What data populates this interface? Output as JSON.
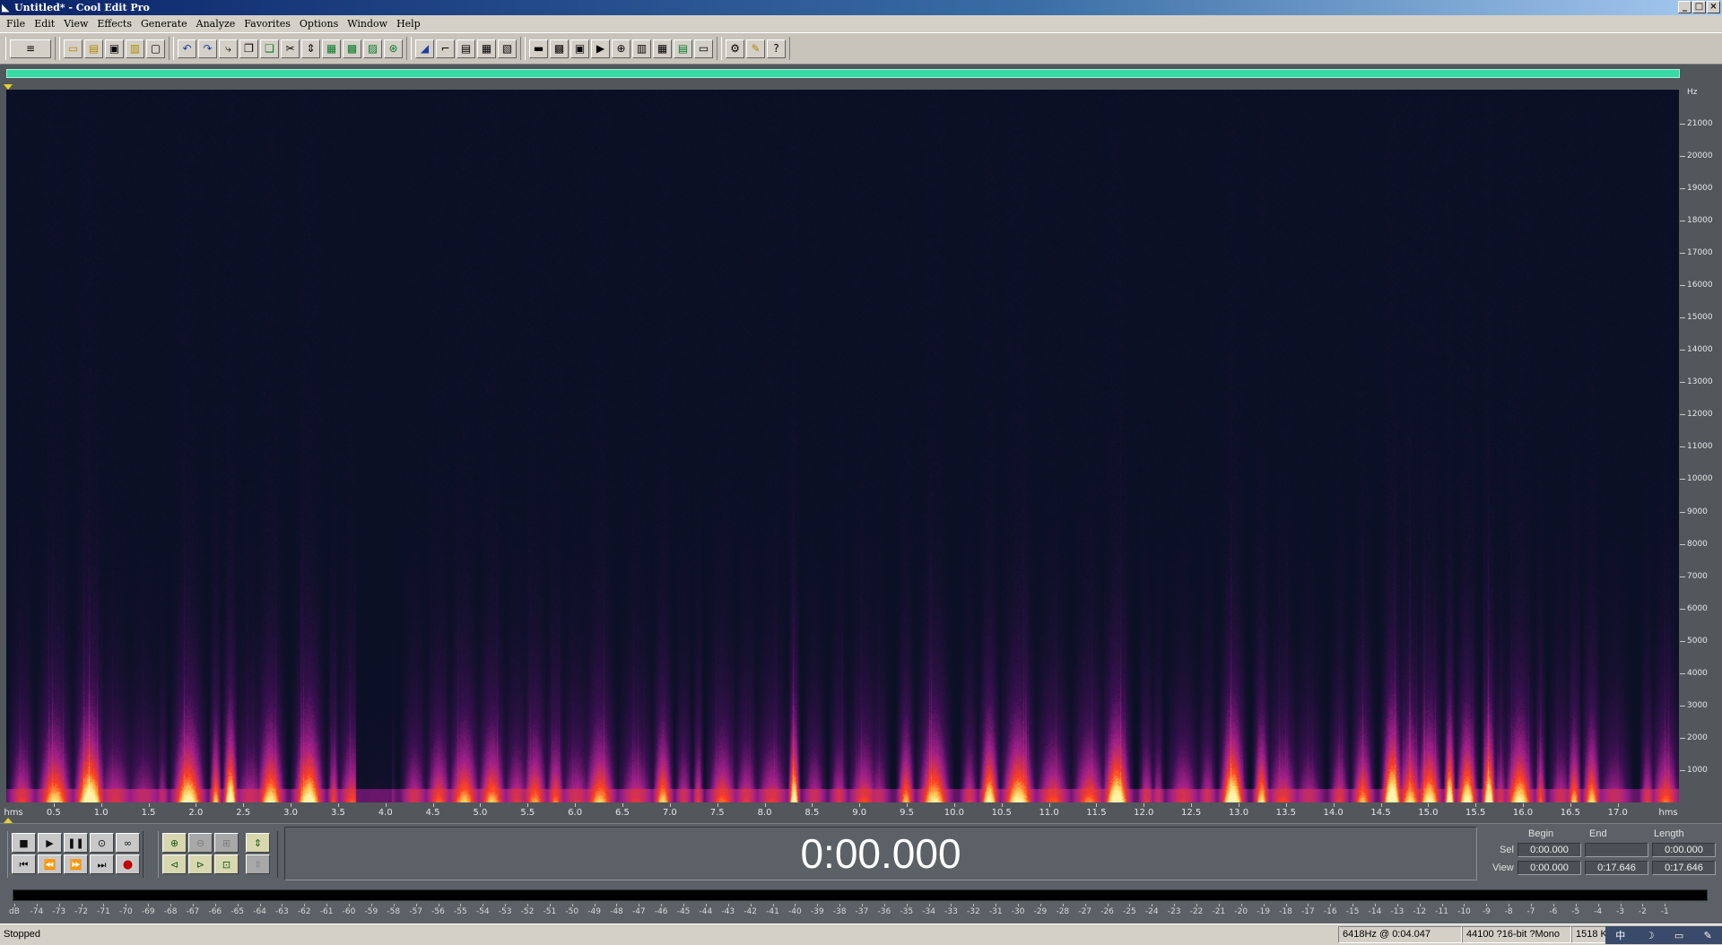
{
  "window": {
    "title": "Untitled* - Cool Edit Pro",
    "controls": [
      "_",
      "□",
      "×"
    ]
  },
  "menu": [
    "File",
    "Edit",
    "View",
    "Effects",
    "Generate",
    "Analyze",
    "Favorites",
    "Options",
    "Window",
    "Help"
  ],
  "toolbar": {
    "groups": [
      [
        {
          "icon": "waveform-toggle-icon",
          "glyph": "≡",
          "wide": true
        }
      ],
      [
        {
          "icon": "new-file-icon",
          "glyph": "▭",
          "c": "y"
        },
        {
          "icon": "open-file-icon",
          "glyph": "▤",
          "c": "y"
        },
        {
          "icon": "save-icon",
          "glyph": "▣"
        },
        {
          "icon": "save-as-icon",
          "glyph": "▥",
          "c": "y"
        },
        {
          "icon": "close-file-icon",
          "glyph": "▢"
        }
      ],
      [
        {
          "icon": "undo-icon",
          "glyph": "↶",
          "c": "b"
        },
        {
          "icon": "redo-icon",
          "glyph": "↷",
          "c": "b"
        },
        {
          "icon": "repeat-icon",
          "glyph": "⤷"
        },
        {
          "icon": "copy-icon",
          "glyph": "❐"
        },
        {
          "icon": "copy-new-icon",
          "glyph": "❏",
          "c": "g"
        },
        {
          "icon": "cut-icon",
          "glyph": "✂"
        },
        {
          "icon": "trim-icon",
          "glyph": "⇕"
        },
        {
          "icon": "paste-icon",
          "glyph": "▦",
          "c": "g"
        },
        {
          "icon": "paste-new-icon",
          "glyph": "▩",
          "c": "g"
        },
        {
          "icon": "mix-paste-icon",
          "glyph": "▨",
          "c": "g"
        },
        {
          "icon": "mix-icon",
          "glyph": "⊛",
          "c": "g"
        }
      ],
      [
        {
          "icon": "amplify-icon",
          "glyph": "◢",
          "c": "b"
        },
        {
          "icon": "envelope-icon",
          "glyph": "⌐"
        },
        {
          "icon": "noise-reduction-icon",
          "glyph": "▤"
        },
        {
          "icon": "filter-icon",
          "glyph": "▦"
        },
        {
          "icon": "eq-icon",
          "glyph": "▧"
        }
      ],
      [
        {
          "icon": "waveform-view-icon",
          "glyph": "▬"
        },
        {
          "icon": "spectral-view-icon",
          "glyph": "▩"
        },
        {
          "icon": "snap-icon",
          "glyph": "▣"
        },
        {
          "icon": "play-preview-icon",
          "glyph": "▶"
        },
        {
          "icon": "zoom-view-icon",
          "glyph": "⊕"
        },
        {
          "icon": "analyze-icon",
          "glyph": "▥"
        },
        {
          "icon": "cue-list-icon",
          "glyph": "▦"
        },
        {
          "icon": "info-icon",
          "glyph": "▤",
          "c": "g"
        },
        {
          "icon": "mono-icon",
          "glyph": "▭"
        }
      ],
      [
        {
          "icon": "settings-icon",
          "glyph": "⚙"
        },
        {
          "icon": "script-icon",
          "glyph": "✎",
          "c": "y"
        },
        {
          "icon": "help-icon",
          "glyph": "?"
        }
      ]
    ]
  },
  "spectral": {
    "y_unit": "Hz",
    "y_labels": [
      "21000",
      "20000",
      "19000",
      "18000",
      "17000",
      "16000",
      "15000",
      "14000",
      "13000",
      "12000",
      "11000",
      "10000",
      "9000",
      "8000",
      "7000",
      "6000",
      "5000",
      "4000",
      "3000",
      "2000",
      "1000"
    ],
    "x_unit": "hms",
    "x_labels": [
      "0.5",
      "1.0",
      "1.5",
      "2.0",
      "2.5",
      "3.0",
      "3.5",
      "4.0",
      "4.5",
      "5.0",
      "5.5",
      "6.0",
      "6.5",
      "7.0",
      "7.5",
      "8.0",
      "8.5",
      "9.0",
      "9.5",
      "10.0",
      "10.5",
      "11.0",
      "11.5",
      "12.0",
      "12.5",
      "13.0",
      "13.5",
      "14.0",
      "14.5",
      "15.0",
      "15.5",
      "16.0",
      "16.5",
      "17.0"
    ],
    "duration_s": 17.646,
    "max_hz": 22050,
    "colors": {
      "background": "#0a1024",
      "low": "#3a1050",
      "mid": "#a0208a",
      "high": "#ff4020",
      "peak": "#fff0a0"
    }
  },
  "transport": {
    "row1": [
      {
        "icon": "stop-icon",
        "glyph": "■"
      },
      {
        "icon": "play-icon",
        "glyph": "▶"
      },
      {
        "icon": "pause-icon",
        "glyph": "❚❚"
      },
      {
        "icon": "play-to-end-icon",
        "glyph": "⊙"
      },
      {
        "icon": "loop-icon",
        "glyph": "∞"
      }
    ],
    "row2": [
      {
        "icon": "go-to-start-icon",
        "glyph": "⏮"
      },
      {
        "icon": "rewind-icon",
        "glyph": "⏪"
      },
      {
        "icon": "fast-forward-icon",
        "glyph": "⏩"
      },
      {
        "icon": "go-to-end-icon",
        "glyph": "⏭"
      },
      {
        "icon": "record-icon",
        "glyph": "●",
        "rec": true
      }
    ],
    "zoom_row1": [
      {
        "icon": "zoom-in-icon",
        "glyph": "⊕",
        "on": true
      },
      {
        "icon": "zoom-out-icon",
        "glyph": "⊖",
        "on": false
      },
      {
        "icon": "zoom-full-icon",
        "glyph": "⊞",
        "on": false
      },
      {
        "icon": "zoom-vertical-in-icon",
        "glyph": "⇕",
        "on": true
      }
    ],
    "zoom_row2": [
      {
        "icon": "zoom-left-icon",
        "glyph": "⊲",
        "on": true
      },
      {
        "icon": "zoom-right-icon",
        "glyph": "⊳",
        "on": true
      },
      {
        "icon": "zoom-selection-icon",
        "glyph": "⊡",
        "on": true
      },
      {
        "icon": "zoom-vertical-out-icon",
        "glyph": "⇳",
        "on": false
      }
    ],
    "time": "0:00.000"
  },
  "selview": {
    "headers": {
      "begin": "Begin",
      "end": "End",
      "length": "Length"
    },
    "sel": {
      "label": "Sel",
      "begin": "0:00.000",
      "end": "",
      "length": "0:00.000"
    },
    "view": {
      "label": "View",
      "begin": "0:00.000",
      "end": "0:17.646",
      "length": "0:17.646"
    }
  },
  "meter": {
    "labels": [
      "dB",
      "-74",
      "-73",
      "-72",
      "-71",
      "-70",
      "-69",
      "-68",
      "-67",
      "-66",
      "-65",
      "-64",
      "-63",
      "-62",
      "-61",
      "-60",
      "-59",
      "-58",
      "-57",
      "-56",
      "-55",
      "-54",
      "-53",
      "-52",
      "-51",
      "-50",
      "-49",
      "-48",
      "-47",
      "-46",
      "-45",
      "-44",
      "-43",
      "-42",
      "-41",
      "-40",
      "-39",
      "-38",
      "-37",
      "-36",
      "-35",
      "-34",
      "-33",
      "-32",
      "-31",
      "-30",
      "-29",
      "-28",
      "-27",
      "-26",
      "-25",
      "-24",
      "-23",
      "-22",
      "-21",
      "-20",
      "-19",
      "-18",
      "-17",
      "-16",
      "-15",
      "-14",
      "-13",
      "-12",
      "-11",
      "-10",
      "-9",
      "-8",
      "-7",
      "-6",
      "-5",
      "-4",
      "-3",
      "-2",
      "-1"
    ]
  },
  "status": {
    "state": "Stopped",
    "cursor": "6418Hz @  0:04.047",
    "format": "44100 ?16-bit ?Mono",
    "size": "1518 K",
    "tray": [
      "中",
      "☽",
      "▭",
      "✎"
    ]
  }
}
